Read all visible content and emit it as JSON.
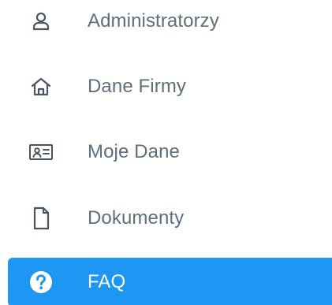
{
  "sidebar": {
    "items": [
      {
        "label": "Administratorzy",
        "icon": "user-icon",
        "active": false
      },
      {
        "label": "Dane Firmy",
        "icon": "home-icon",
        "active": false
      },
      {
        "label": "Moje Dane",
        "icon": "id-card-icon",
        "active": false
      },
      {
        "label": "Dokumenty",
        "icon": "document-icon",
        "active": false
      },
      {
        "label": "FAQ",
        "icon": "question-circle-icon",
        "active": true
      }
    ]
  },
  "colors": {
    "text": "#5e6e7c",
    "icon": "#4a5561",
    "active_background": "#1e96f3",
    "active_text": "#ffffff"
  }
}
